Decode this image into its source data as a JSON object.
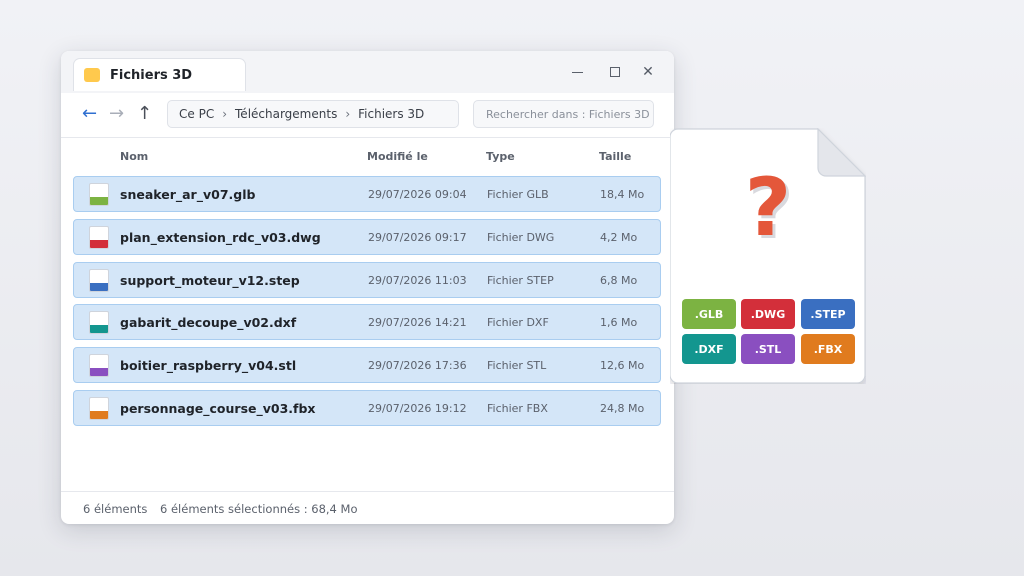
{
  "window": {
    "tab_title": "Fichiers 3D",
    "controls": {
      "minimize": "—",
      "maximize": "□",
      "close": "✕"
    }
  },
  "nav": {
    "back": "←",
    "forward": "→",
    "up": "↑",
    "breadcrumb": [
      "Ce PC",
      "Téléchargements",
      "Fichiers 3D"
    ],
    "breadcrumb_sep": "›",
    "search_placeholder": "Rechercher dans : Fichiers 3D"
  },
  "columns": {
    "name": "Nom",
    "modified": "Modifié le",
    "type": "Type",
    "size": "Taille"
  },
  "files": [
    {
      "name": "sneaker_ar_v07.glb",
      "modified": "29/07/2026 09:04",
      "type": "Fichier GLB",
      "size": "18,4 Mo",
      "color": "#7cb342"
    },
    {
      "name": "plan_extension_rdc_v03.dwg",
      "modified": "29/07/2026 09:17",
      "type": "Fichier DWG",
      "size": "4,2 Mo",
      "color": "#d32f3a"
    },
    {
      "name": "support_moteur_v12.step",
      "modified": "29/07/2026 11:03",
      "type": "Fichier STEP",
      "size": "6,8 Mo",
      "color": "#3a6fc1"
    },
    {
      "name": "gabarit_decoupe_v02.dxf",
      "modified": "29/07/2026 14:21",
      "type": "Fichier DXF",
      "size": "1,6 Mo",
      "color": "#13968f"
    },
    {
      "name": "boitier_raspberry_v04.stl",
      "modified": "29/07/2026 17:36",
      "type": "Fichier STL",
      "size": "12,6 Mo",
      "color": "#8a4fc0"
    },
    {
      "name": "personnage_course_v03.fbx",
      "modified": "29/07/2026 19:12",
      "type": "Fichier FBX",
      "size": "24,8 Mo",
      "color": "#e07b1e"
    }
  ],
  "status": {
    "count": "6 éléments",
    "selection": "6 éléments sélectionnés : 68,4 Mo"
  },
  "unknown_doc": {
    "symbol": "?",
    "badges": [
      {
        "label": ".GLB",
        "color": "#7cb342"
      },
      {
        "label": ".DWG",
        "color": "#d32f3a"
      },
      {
        "label": ".STEP",
        "color": "#3a6fc1"
      },
      {
        "label": ".DXF",
        "color": "#13968f"
      },
      {
        "label": ".STL",
        "color": "#8a4fc0"
      },
      {
        "label": ".FBX",
        "color": "#e07b1e"
      }
    ]
  },
  "icons": [
    "folder-icon",
    "back-arrow-icon",
    "forward-arrow-icon",
    "up-arrow-icon",
    "file-icon",
    "question-mark-icon"
  ]
}
